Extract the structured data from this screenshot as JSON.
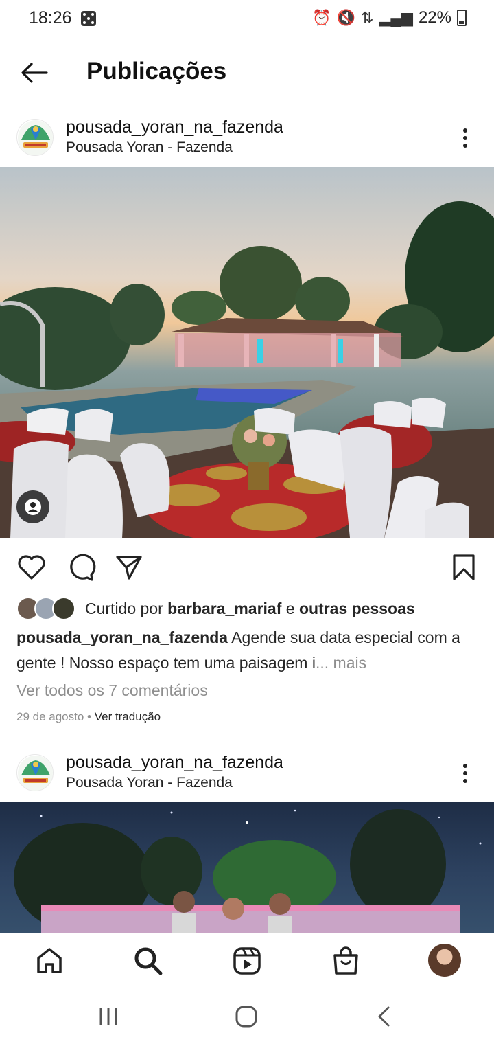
{
  "status_bar": {
    "time": "18:26",
    "battery": "22%"
  },
  "header": {
    "title": "Publicações"
  },
  "posts": [
    {
      "username": "pousada_yoran_na_fazenda",
      "location": "Pousada Yoran - Fazenda",
      "liked_by_prefix": "Curtido por ",
      "liked_by_user": "barbara_mariaf",
      "liked_by_connector": " e ",
      "liked_by_others": "outras pessoas",
      "caption_text": " Agende sua data especial com a gente ! Nosso espaço tem uma paisagem i",
      "caption_more": "... mais",
      "comments_link": "Ver todos os 7 comentários",
      "date": "29 de agosto",
      "date_separator": " • ",
      "translate": "Ver tradução"
    },
    {
      "username": "pousada_yoran_na_fazenda",
      "location": "Pousada Yoran - Fazenda"
    }
  ],
  "icons": {
    "back": "arrow-left",
    "more": "three-dots-vertical",
    "like": "heart-outline",
    "comment": "comment-bubble",
    "share": "paper-plane",
    "save": "bookmark-outline",
    "nav": [
      "home",
      "search",
      "reels",
      "shop",
      "profile"
    ]
  },
  "colors": {
    "text": "#262626",
    "muted": "#8e8e8e"
  }
}
